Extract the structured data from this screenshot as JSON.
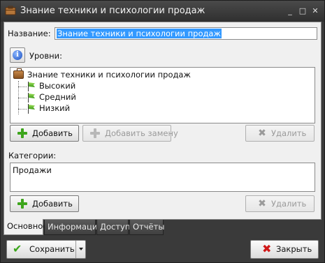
{
  "window": {
    "title": "Знание техники и психологии продаж",
    "controls": {
      "minimize": "_",
      "maximize": "□",
      "close": "✕"
    }
  },
  "form": {
    "name_label": "Название:",
    "name_value": "Знание техники и психологии продаж",
    "levels_label": "Уровни:",
    "tree": {
      "root": "Знание техники и психологии продаж",
      "items": [
        "Высокий",
        "Средний",
        "Низкий"
      ]
    },
    "levels_buttons": {
      "add": "Добавить",
      "add_replace": "Добавить замену",
      "delete": "Удалить"
    },
    "categories_label": "Категории:",
    "categories": [
      "Продажи"
    ],
    "categories_buttons": {
      "add": "Добавить",
      "delete": "Удалить"
    }
  },
  "tabs": [
    {
      "label": "Основное",
      "active": true
    },
    {
      "label": "Информация",
      "active": false
    },
    {
      "label": "Доступ",
      "active": false
    },
    {
      "label": "Отчёты",
      "active": false
    }
  ],
  "footer": {
    "save": "Сохранить",
    "close": "Закрыть"
  },
  "icons": {
    "info": "i",
    "check": "✔",
    "x": "✖"
  }
}
